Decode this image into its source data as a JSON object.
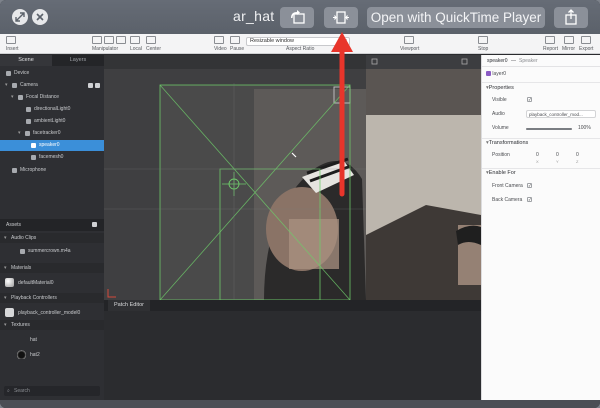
{
  "quicklook": {
    "title": "ar_hat",
    "open_with_label": "Open with QuickTime Player"
  },
  "toolbar": {
    "insert_label": "Insert",
    "manipulator_label": "Manipulator",
    "local_label": "Local",
    "center_label": "Center",
    "video_label": "Video",
    "pause_label": "Pause",
    "resize_value": "Resizable window",
    "aspect_label": "Aspect Ratio",
    "viewport_label": "Viewport",
    "stop_label": "Stop",
    "report_label": "Report",
    "mirror_label": "Mirror",
    "export_label": "Export"
  },
  "scene_panel": {
    "tabs": [
      "Scene",
      "Layers"
    ],
    "items": [
      {
        "label": "Device",
        "indent": 0
      },
      {
        "label": "Camera",
        "indent": 1
      },
      {
        "label": "Focal Distance",
        "indent": 2
      },
      {
        "label": "directionalLight0",
        "indent": 3
      },
      {
        "label": "ambientLight0",
        "indent": 3
      },
      {
        "label": "facetracker0",
        "indent": 2
      },
      {
        "label": "speaker0",
        "indent": 3,
        "selected": true
      },
      {
        "label": "facemesh0",
        "indent": 3
      },
      {
        "label": "Microphone",
        "indent": 1
      }
    ]
  },
  "assets_panel": {
    "title": "Assets",
    "sections": [
      {
        "label": "Audio Clips",
        "items": [
          "summercrown.m4a"
        ]
      },
      {
        "label": "Materials",
        "items": [
          "defaultMaterial0"
        ]
      },
      {
        "label": "Playback Controllers",
        "items": [
          "playback_controller_model0"
        ]
      },
      {
        "label": "Textures",
        "items": [
          "hat",
          "hat2"
        ]
      }
    ],
    "search_placeholder": "Search"
  },
  "patch_editor": {
    "tab_label": "Patch Editor"
  },
  "inspector": {
    "header_name": "speaker0",
    "header_type": "Speaker",
    "layer": "layer0",
    "properties_label": "Properties",
    "visible_label": "Visible",
    "audio_label": "Audio",
    "audio_value": "playback_controller_mod...",
    "volume_label": "Volume",
    "volume_value": "100%",
    "volume_level": 1.0,
    "transformations_label": "Transformations",
    "position_label": "Position",
    "position_values": [
      "0",
      "0",
      "0"
    ],
    "axes": [
      "X",
      "Y",
      "Z"
    ],
    "enable_for_label": "Enable For",
    "front_camera_label": "Front Camera",
    "back_camera_label": "Back Camera"
  },
  "colors": {
    "selection": "#3b8fd9",
    "arrow": "#e8352b",
    "guide": "#6ecb6a"
  }
}
